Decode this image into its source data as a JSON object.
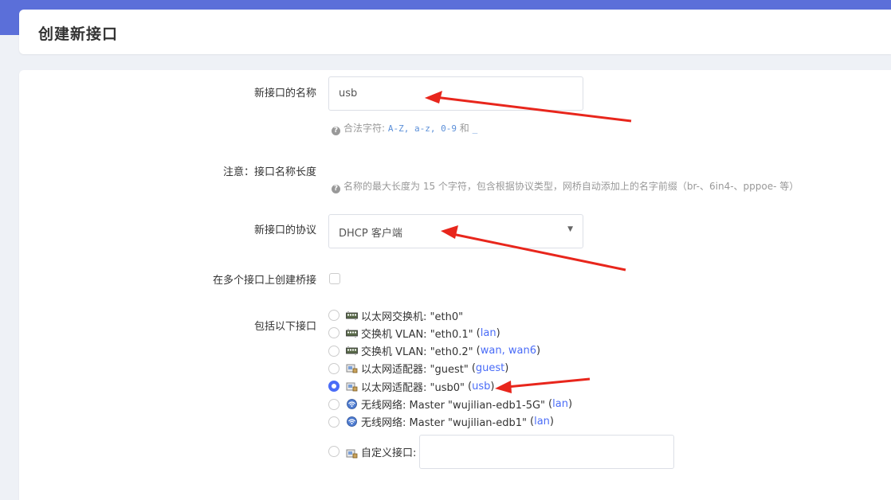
{
  "header": {
    "title": "创建新接口"
  },
  "form": {
    "name": {
      "label": "新接口的名称",
      "value": "usb",
      "hint_prefix": "合法字符:",
      "hint_chars": "A-Z, a-z, 0-9",
      "hint_and": "和",
      "hint_underscore": "_"
    },
    "note": {
      "label": "注意：接口名称长度",
      "hint": "名称的最大长度为 15 个字符，包含根据协议类型，网桥自动添加上的名字前缀（br-、6in4-、pppoe- 等）"
    },
    "protocol": {
      "label": "新接口的协议",
      "value": "DHCP 客户端"
    },
    "bridge": {
      "label": "在多个接口上创建桥接",
      "checked": false
    },
    "interfaces": {
      "label": "包括以下接口",
      "items": [
        {
          "icon": "switch-icon",
          "text": "以太网交换机: \"eth0\"",
          "link": "",
          "selected": false
        },
        {
          "icon": "switch-icon",
          "text": "交换机 VLAN: \"eth0.1\"",
          "link": "lan",
          "selected": false
        },
        {
          "icon": "switch-icon",
          "text": "交换机 VLAN: \"eth0.2\"",
          "link": "wan, wan6",
          "selected": false
        },
        {
          "icon": "ethernet-adapter-icon",
          "text": "以太网适配器: \"guest\"",
          "link": "guest",
          "selected": false
        },
        {
          "icon": "ethernet-adapter-icon",
          "text": "以太网适配器: \"usb0\"",
          "link": "usb",
          "selected": true
        },
        {
          "icon": "wireless-icon",
          "text": "无线网络: Master \"wujilian-edb1-5G\"",
          "link": "lan",
          "selected": false
        },
        {
          "icon": "wireless-icon",
          "text": "无线网络: Master \"wujilian-edb1\"",
          "link": "lan",
          "selected": false
        }
      ],
      "custom": {
        "icon": "ethernet-adapter-icon",
        "label": "自定义接口:",
        "value": ""
      }
    }
  },
  "colors": {
    "accent": "#5b6fd9",
    "radio": "#4a6cf7",
    "annotation": "#e8261c"
  }
}
